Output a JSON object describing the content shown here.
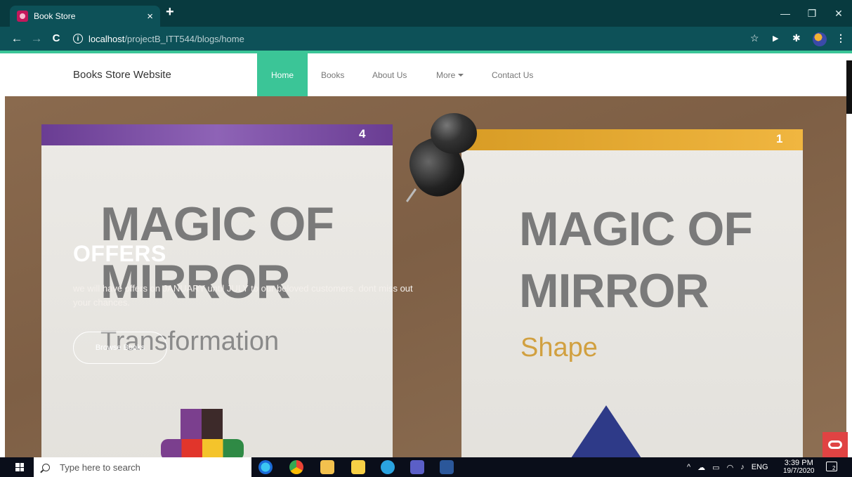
{
  "browser": {
    "tab_title": "Book Store",
    "tab_close": "×",
    "new_tab": "+",
    "url_host": "localhost",
    "url_path": "/projectB_ITT544/blogs/home",
    "info_glyph": "i",
    "back_glyph": "←",
    "forward_glyph": "→",
    "reload_glyph": "C",
    "star_glyph": "☆",
    "window_min": "—",
    "window_restore": "❐",
    "window_close": "✕",
    "menu_glyph": "⋮"
  },
  "site": {
    "brand": "Books Store Website",
    "nav": [
      "Home",
      "Books",
      "About Us",
      "More",
      "Contact Us"
    ],
    "accent_color": "#3bc597"
  },
  "hero": {
    "title": "OFFERS",
    "description": "we will have offers on JANUARY until JULY to our beloved customers. dont miss out your chances.",
    "button": "Browse Books",
    "left_book": {
      "number": "4",
      "line1": "MAGIC OF",
      "line2": "MIRROR",
      "subtitle": "Transformation"
    },
    "right_book": {
      "number": "1",
      "line1": "MAGIC OF",
      "line2": "MIRROR",
      "subtitle": "Shape"
    }
  },
  "taskbar": {
    "search_placeholder": "Type here to search",
    "language": "ENG",
    "time": "3:39 PM",
    "date": "19/7/2020",
    "tray_up": "^",
    "notification_count": "2"
  }
}
